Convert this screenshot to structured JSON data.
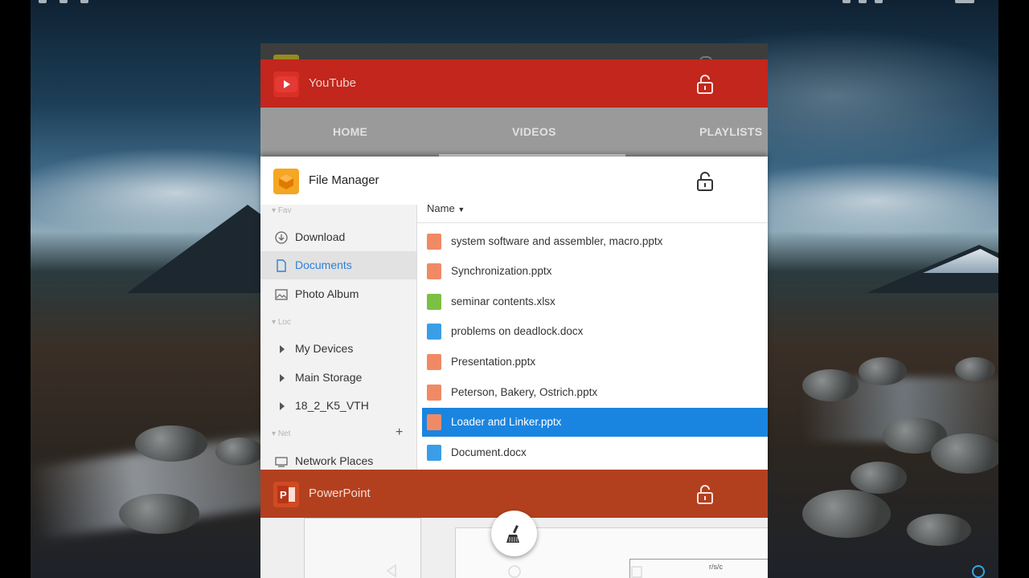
{
  "cards": {
    "youtube": {
      "name": "YouTube",
      "icon": "youtube-icon",
      "color": "#c2261c",
      "tabs": [
        {
          "label": "HOME"
        },
        {
          "label": "VIDEOS"
        },
        {
          "label": "PLAYLISTS"
        }
      ],
      "active_tab": "VIDEOS"
    },
    "file_manager": {
      "name": "File Manager",
      "icon": "file-manager-icon",
      "sidebar": {
        "sections": [
          "Fav",
          "Loc",
          "Net"
        ],
        "fav_items": [
          {
            "label": "Download",
            "icon": "download-icon"
          },
          {
            "label": "Documents",
            "icon": "document-icon",
            "active": true
          },
          {
            "label": "Photo Album",
            "icon": "photo-icon"
          }
        ],
        "loc_items": [
          {
            "label": "My Devices"
          },
          {
            "label": "Main Storage"
          },
          {
            "label": "18_2_K5_VTH"
          }
        ],
        "net_items": [
          {
            "label": "Network Places",
            "icon": "network-icon"
          }
        ],
        "net_add": "+"
      },
      "column_header": "Name",
      "files": [
        {
          "name": "system software and assembler, macro.pptx",
          "type": "pptx"
        },
        {
          "name": "Synchronization.pptx",
          "type": "pptx"
        },
        {
          "name": "seminar contents.xlsx",
          "type": "xlsx"
        },
        {
          "name": "problems on deadlock.docx",
          "type": "docx"
        },
        {
          "name": "Presentation.pptx",
          "type": "pptx"
        },
        {
          "name": "Peterson, Bakery, Ostrich.pptx",
          "type": "pptx"
        },
        {
          "name": "Loader and Linker.pptx",
          "type": "pptx",
          "selected": true
        },
        {
          "name": "Document.docx",
          "type": "docx"
        }
      ]
    },
    "powerpoint": {
      "name": "PowerPoint",
      "icon": "powerpoint-icon",
      "color": "#b2401f",
      "thumb_text": "r/s/c"
    }
  },
  "clear_all": {
    "icon": "broom-icon"
  },
  "navbar": {
    "icons": [
      "back-icon",
      "home-icon",
      "recents-icon"
    ]
  }
}
